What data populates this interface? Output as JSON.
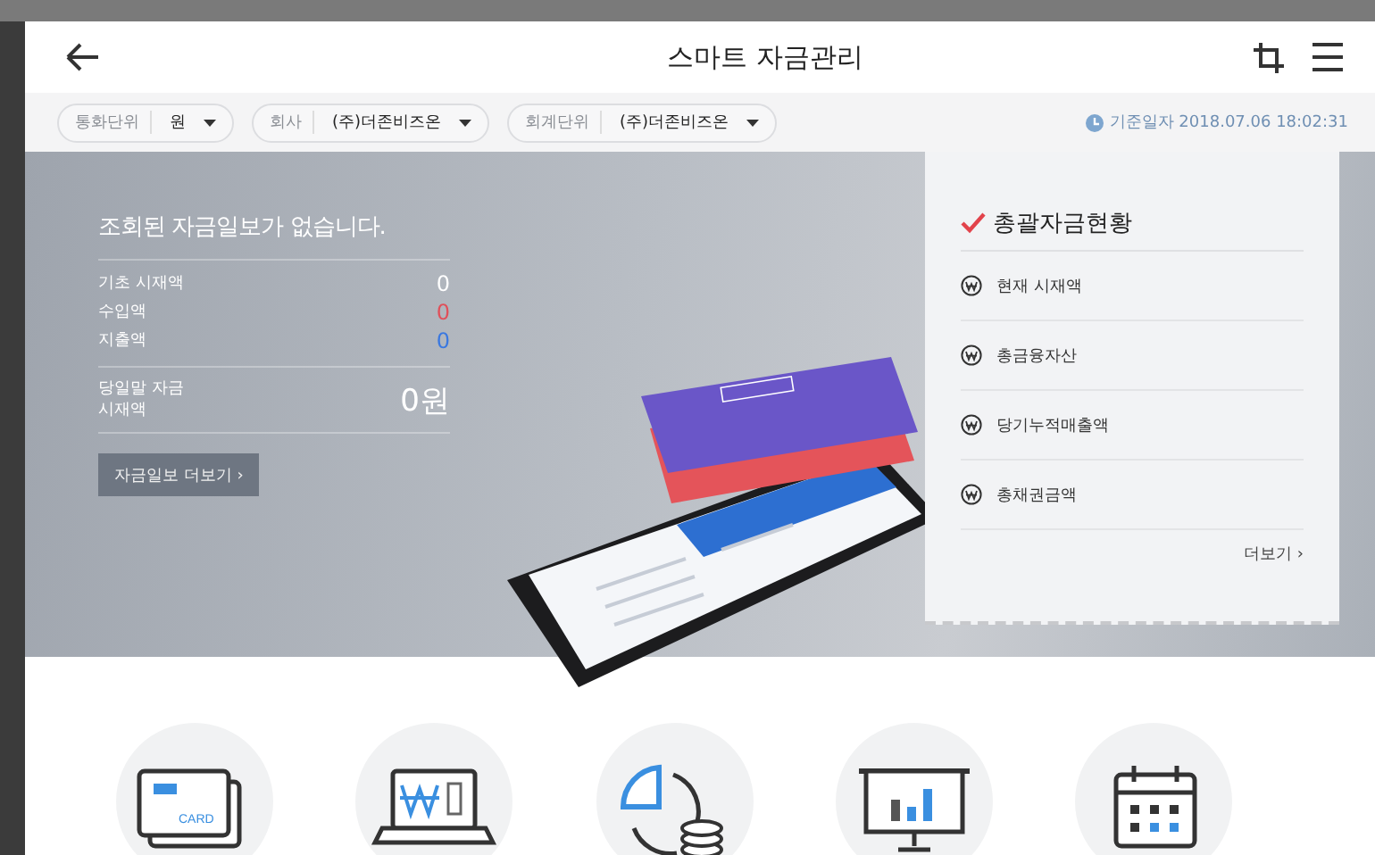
{
  "header": {
    "title": "스마트 자금관리"
  },
  "filters": [
    {
      "label": "통화단위",
      "value": "원"
    },
    {
      "label": "회사",
      "value": "(주)더존비즈온"
    },
    {
      "label": "회계단위",
      "value": "(주)더존비즈온"
    }
  ],
  "reference_date": "기준일자 2018.07.06 18:02:31",
  "daily_report": {
    "message": "조회된 자금일보가 없습니다.",
    "rows": [
      {
        "label": "기초 시재액",
        "value": "0",
        "color": "#ffffff"
      },
      {
        "label": "수입액",
        "value": "0",
        "color": "#e0505a"
      },
      {
        "label": "지출액",
        "value": "0",
        "color": "#3a78e0"
      }
    ],
    "total_label": "당일말 자금 시재액",
    "total_value": "0원",
    "button": "자금일보 더보기 ›"
  },
  "summary": {
    "title": "총괄자금현황",
    "items": [
      "현재 시재액",
      "총금융자산",
      "당기누적매출액",
      "총채권금액"
    ],
    "more": "더보기 ›"
  },
  "shortcuts": [
    {
      "kind": "card",
      "icon_text": "CARD"
    },
    {
      "kind": "laptop"
    },
    {
      "kind": "pie"
    },
    {
      "kind": "presentation"
    },
    {
      "kind": "calendar"
    }
  ]
}
